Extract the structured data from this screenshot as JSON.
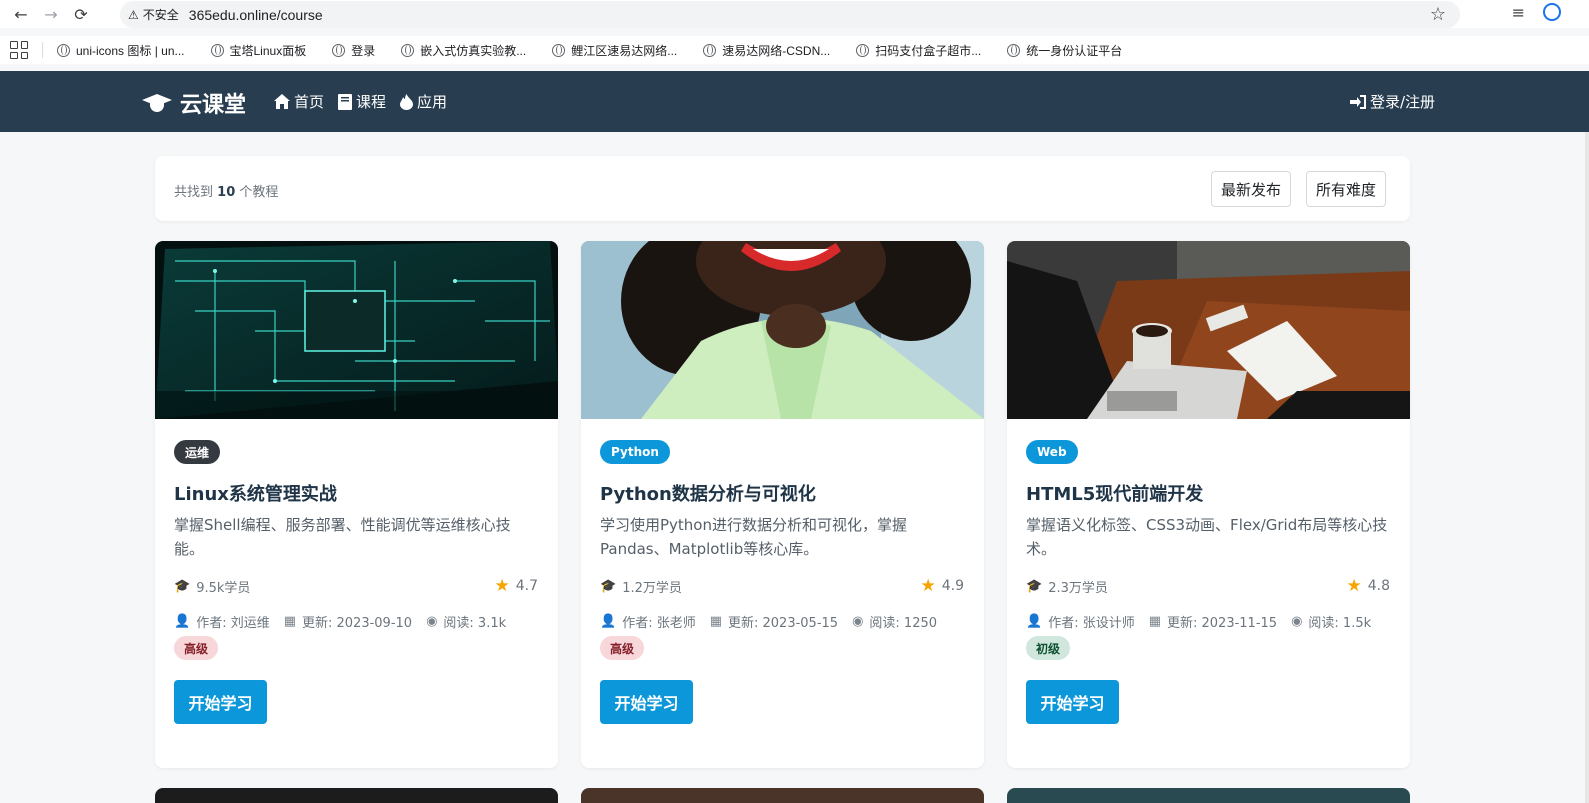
{
  "browser": {
    "security_label": "不安全",
    "url": "365edu.online/course",
    "bookmarks": [
      {
        "label": "uni-icons 图标 | un..."
      },
      {
        "label": "宝塔Linux面板"
      },
      {
        "label": "登录"
      },
      {
        "label": "嵌入式仿真实验教..."
      },
      {
        "label": "鲤江区速易达网络..."
      },
      {
        "label": "速易达网络-CSDN..."
      },
      {
        "label": "扫码支付盒子超市..."
      },
      {
        "label": "统一身份认证平台"
      }
    ]
  },
  "header": {
    "brand": "云课堂",
    "nav": [
      {
        "label": "首页",
        "icon": "home-icon"
      },
      {
        "label": "课程",
        "icon": "book-icon"
      },
      {
        "label": "应用",
        "icon": "fire-icon"
      }
    ],
    "login_label": "登录/注册"
  },
  "filter": {
    "found_prefix": "共找到",
    "found_count": "10",
    "found_suffix": "个教程",
    "sort_label": "最新发布",
    "difficulty_label": "所有难度"
  },
  "courses": [
    {
      "tag": "运维",
      "tag_color": "#343a40",
      "title": "Linux系统管理实战",
      "description": "掌握Shell编程、服务部署、性能调优等运维核心技能。",
      "students": "9.5k学员",
      "rating": "4.7",
      "author": "作者: 刘运维",
      "updated": "更新: 2023-09-10",
      "views": "阅读: 3.1k",
      "level": "高级",
      "cta": "开始学习"
    },
    {
      "tag": "Python",
      "tag_color": "#0b97d9",
      "title": "Python数据分析与可视化",
      "description": "学习使用Python进行数据分析和可视化，掌握Pandas、Matplotlib等核心库。",
      "students": "1.2万学员",
      "rating": "4.9",
      "author": "作者: 张老师",
      "updated": "更新: 2023-05-15",
      "views": "阅读: 1250",
      "level": "高级",
      "cta": "开始学习"
    },
    {
      "tag": "Web",
      "tag_color": "#0b97d9",
      "title": "HTML5现代前端开发",
      "description": "掌握语义化标签、CSS3动画、Flex/Grid布局等核心技术。",
      "students": "2.3万学员",
      "rating": "4.8",
      "author": "作者: 张设计师",
      "updated": "更新: 2023-11-15",
      "views": "阅读: 1.5k",
      "level": "初级",
      "cta": "开始学习"
    }
  ]
}
